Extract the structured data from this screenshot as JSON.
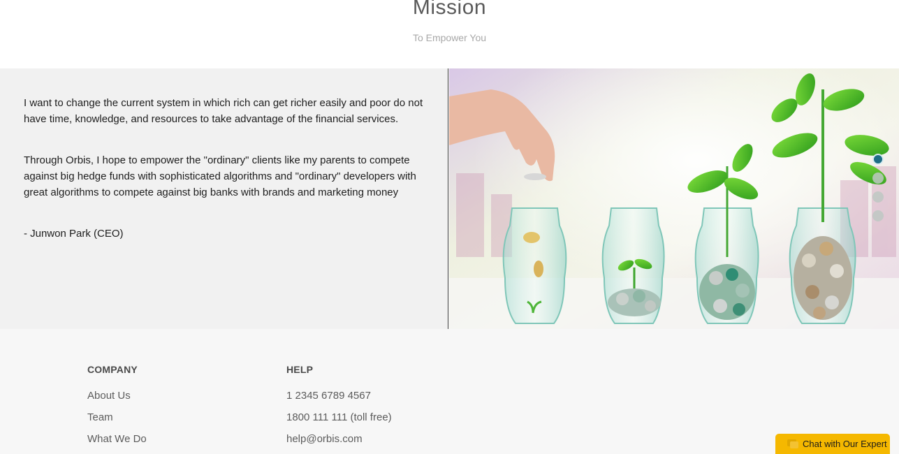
{
  "mission": {
    "title": "Mission",
    "subtitle": "To Empower You"
  },
  "quote": {
    "paragraph1": "I want to change the current system in which rich can get richer easily and poor do not have time, knowledge, and resources to take advantage of the financial services.",
    "paragraph2": "Through Orbis, I hope to empower the \"ordinary\" clients like my parents to compete against big hedge funds with sophisticated algorithms and \"ordinary\" developers with great algorithms to compete against big banks with brands and marketing money",
    "signature": "- Junwon Park (CEO)"
  },
  "carousel": {
    "image_subject": "hand dropping coins into glass jars with growing plant sprouts",
    "slide_count": 4,
    "active_slide": 1,
    "active_color": "#1f6e86"
  },
  "footer": {
    "company": {
      "title": "COMPANY",
      "links": [
        "About Us",
        "Team",
        "What We Do"
      ]
    },
    "help": {
      "title": "HELP",
      "items": [
        "1 2345 6789 4567",
        "1800 111 111 (toll free)",
        "help@orbis.com"
      ]
    }
  },
  "chat": {
    "label": "Chat with Our Expert",
    "icon": "chat-bubbles-icon",
    "color": "#f5b800"
  }
}
